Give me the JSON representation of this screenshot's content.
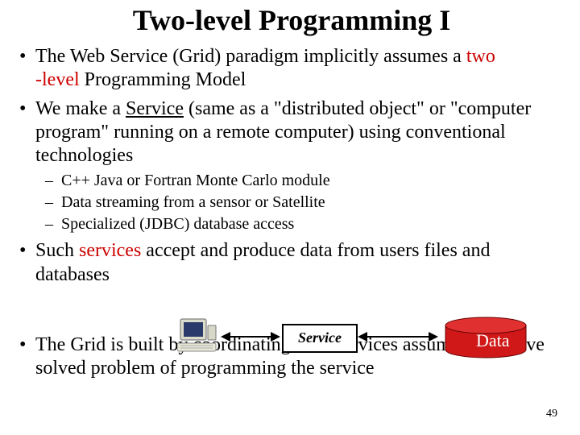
{
  "title": "Two-level Programming I",
  "bullets": {
    "b1": {
      "t1": "The Web Service (Grid) paradigm implicitly assumes a ",
      "hl1": "two",
      "hl2": "-level",
      "t2": " Programming Model"
    },
    "b2": {
      "t1": "We make a ",
      "u1": "Service",
      "t2": " (same as a \"distributed object\" or \"computer program\" running on a remote computer) using conventional technologies"
    },
    "sub": {
      "s1": "C++ Java or Fortran Monte Carlo module",
      "s2": "Data streaming from a sensor or Satellite",
      "s3": "Specialized (JDBC) database access"
    },
    "b3": {
      "t1": "Such ",
      "hl1": "services",
      "t2": " accept and produce data from users files and databases"
    },
    "b4": {
      "t1": "The Grid is built by coordinating such services assuming we have solved problem of programming the service"
    }
  },
  "diagram": {
    "service_label": "Service",
    "data_label": "Data"
  },
  "page_number": "49"
}
